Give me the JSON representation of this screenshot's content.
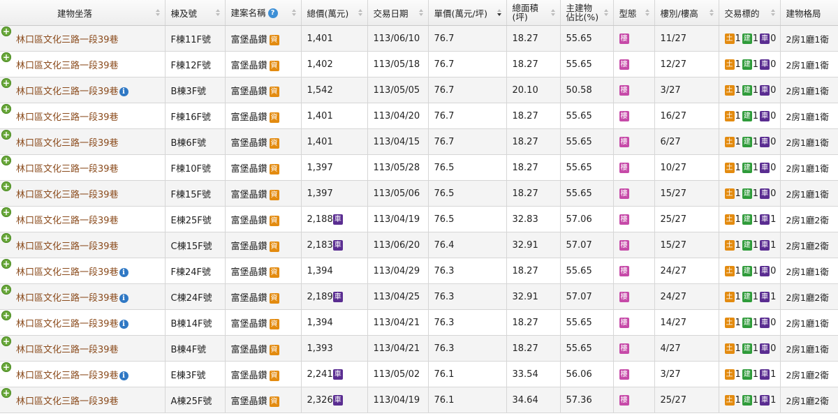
{
  "columns": [
    {
      "label": "建物坐落"
    },
    {
      "label": "棟及號"
    },
    {
      "label": "建案名稱"
    },
    {
      "label": "總價(萬元)"
    },
    {
      "label": "交易日期"
    },
    {
      "label": "單價(萬元/坪)"
    },
    {
      "label": "總面積",
      "label2": "(坪)"
    },
    {
      "label": "主建物",
      "label2": "佔比(%)"
    },
    {
      "label": "型態"
    },
    {
      "label": "樓別/樓高"
    },
    {
      "label": "交易標的"
    },
    {
      "label": "建物格局"
    }
  ],
  "badges": {
    "land": "土",
    "building": "建",
    "car": "車",
    "info": "資",
    "type": "樓"
  },
  "colors": {
    "land": "#e38b10",
    "building": "#2f9b3a",
    "car": "#5a2d91",
    "type": "#c64aa8",
    "address": "#8a4a1b"
  },
  "rows": [
    {
      "addr": "林口區文化三路一段39巷",
      "info": false,
      "unit": "F棟11F號",
      "project": "富堡晶鑽",
      "total": "1,401",
      "car": false,
      "date": "113/06/10",
      "price": "76.7",
      "area": "18.27",
      "ratio": "55.65",
      "floor": "11/27",
      "tx": [
        "1",
        "1",
        "0"
      ],
      "plan": "2房1廳1衛"
    },
    {
      "addr": "林口區文化三路一段39巷",
      "info": false,
      "unit": "F棟12F號",
      "project": "富堡晶鑽",
      "total": "1,402",
      "car": false,
      "date": "113/05/18",
      "price": "76.7",
      "area": "18.27",
      "ratio": "55.65",
      "floor": "12/27",
      "tx": [
        "1",
        "1",
        "0"
      ],
      "plan": "2房1廳1衛"
    },
    {
      "addr": "林口區文化三路一段39巷",
      "info": true,
      "unit": "B棟3F號",
      "project": "富堡晶鑽",
      "total": "1,542",
      "car": false,
      "date": "113/05/05",
      "price": "76.7",
      "area": "20.10",
      "ratio": "50.58",
      "floor": "3/27",
      "tx": [
        "1",
        "1",
        "0"
      ],
      "plan": "2房1廳1衛"
    },
    {
      "addr": "林口區文化三路一段39巷",
      "info": false,
      "unit": "F棟16F號",
      "project": "富堡晶鑽",
      "total": "1,401",
      "car": false,
      "date": "113/04/20",
      "price": "76.7",
      "area": "18.27",
      "ratio": "55.65",
      "floor": "16/27",
      "tx": [
        "1",
        "1",
        "0"
      ],
      "plan": "2房1廳1衛"
    },
    {
      "addr": "林口區文化三路一段39巷",
      "info": false,
      "unit": "B棟6F號",
      "project": "富堡晶鑽",
      "total": "1,401",
      "car": false,
      "date": "113/04/15",
      "price": "76.7",
      "area": "18.27",
      "ratio": "55.65",
      "floor": "6/27",
      "tx": [
        "1",
        "1",
        "0"
      ],
      "plan": "2房1廳1衛"
    },
    {
      "addr": "林口區文化三路一段39巷",
      "info": false,
      "unit": "F棟10F號",
      "project": "富堡晶鑽",
      "total": "1,397",
      "car": false,
      "date": "113/05/28",
      "price": "76.5",
      "area": "18.27",
      "ratio": "55.65",
      "floor": "10/27",
      "tx": [
        "1",
        "1",
        "0"
      ],
      "plan": "2房1廳1衛"
    },
    {
      "addr": "林口區文化三路一段39巷",
      "info": false,
      "unit": "F棟15F號",
      "project": "富堡晶鑽",
      "total": "1,397",
      "car": false,
      "date": "113/05/06",
      "price": "76.5",
      "area": "18.27",
      "ratio": "55.65",
      "floor": "15/27",
      "tx": [
        "1",
        "1",
        "0"
      ],
      "plan": "2房1廳1衛"
    },
    {
      "addr": "林口區文化三路一段39巷",
      "info": false,
      "unit": "E棟25F號",
      "project": "富堡晶鑽",
      "total": "2,188",
      "car": true,
      "date": "113/04/19",
      "price": "76.5",
      "area": "32.83",
      "ratio": "57.06",
      "floor": "25/27",
      "tx": [
        "1",
        "1",
        "1"
      ],
      "plan": "2房1廳2衛"
    },
    {
      "addr": "林口區文化三路一段39巷",
      "info": false,
      "unit": "C棟15F號",
      "project": "富堡晶鑽",
      "total": "2,183",
      "car": true,
      "date": "113/06/20",
      "price": "76.4",
      "area": "32.91",
      "ratio": "57.07",
      "floor": "15/27",
      "tx": [
        "1",
        "1",
        "1"
      ],
      "plan": "2房1廳2衛"
    },
    {
      "addr": "林口區文化三路一段39巷",
      "info": true,
      "unit": "F棟24F號",
      "project": "富堡晶鑽",
      "total": "1,394",
      "car": false,
      "date": "113/04/29",
      "price": "76.3",
      "area": "18.27",
      "ratio": "55.65",
      "floor": "24/27",
      "tx": [
        "1",
        "1",
        "0"
      ],
      "plan": "2房1廳1衛"
    },
    {
      "addr": "林口區文化三路一段39巷",
      "info": true,
      "unit": "C棟24F號",
      "project": "富堡晶鑽",
      "total": "2,189",
      "car": true,
      "date": "113/04/25",
      "price": "76.3",
      "area": "32.91",
      "ratio": "57.07",
      "floor": "24/27",
      "tx": [
        "1",
        "1",
        "1"
      ],
      "plan": "2房1廳2衛"
    },
    {
      "addr": "林口區文化三路一段39巷",
      "info": true,
      "unit": "B棟14F號",
      "project": "富堡晶鑽",
      "total": "1,394",
      "car": false,
      "date": "113/04/21",
      "price": "76.3",
      "area": "18.27",
      "ratio": "55.65",
      "floor": "14/27",
      "tx": [
        "1",
        "1",
        "0"
      ],
      "plan": "2房1廳1衛"
    },
    {
      "addr": "林口區文化三路一段39巷",
      "info": false,
      "unit": "B棟4F號",
      "project": "富堡晶鑽",
      "total": "1,393",
      "car": false,
      "date": "113/04/21",
      "price": "76.3",
      "area": "18.27",
      "ratio": "55.65",
      "floor": "4/27",
      "tx": [
        "1",
        "1",
        "0"
      ],
      "plan": "2房1廳1衛"
    },
    {
      "addr": "林口區文化三路一段39巷",
      "info": true,
      "unit": "E棟3F號",
      "project": "富堡晶鑽",
      "total": "2,241",
      "car": true,
      "date": "113/05/02",
      "price": "76.1",
      "area": "33.54",
      "ratio": "56.06",
      "floor": "3/27",
      "tx": [
        "1",
        "1",
        "1"
      ],
      "plan": "2房1廳2衛"
    },
    {
      "addr": "林口區文化三路一段39巷",
      "info": false,
      "unit": "A棟25F號",
      "project": "富堡晶鑽",
      "total": "2,326",
      "car": true,
      "date": "113/04/19",
      "price": "76.1",
      "area": "34.64",
      "ratio": "57.36",
      "floor": "25/27",
      "tx": [
        "1",
        "1",
        "1"
      ],
      "plan": "2房1廳2衛"
    }
  ]
}
